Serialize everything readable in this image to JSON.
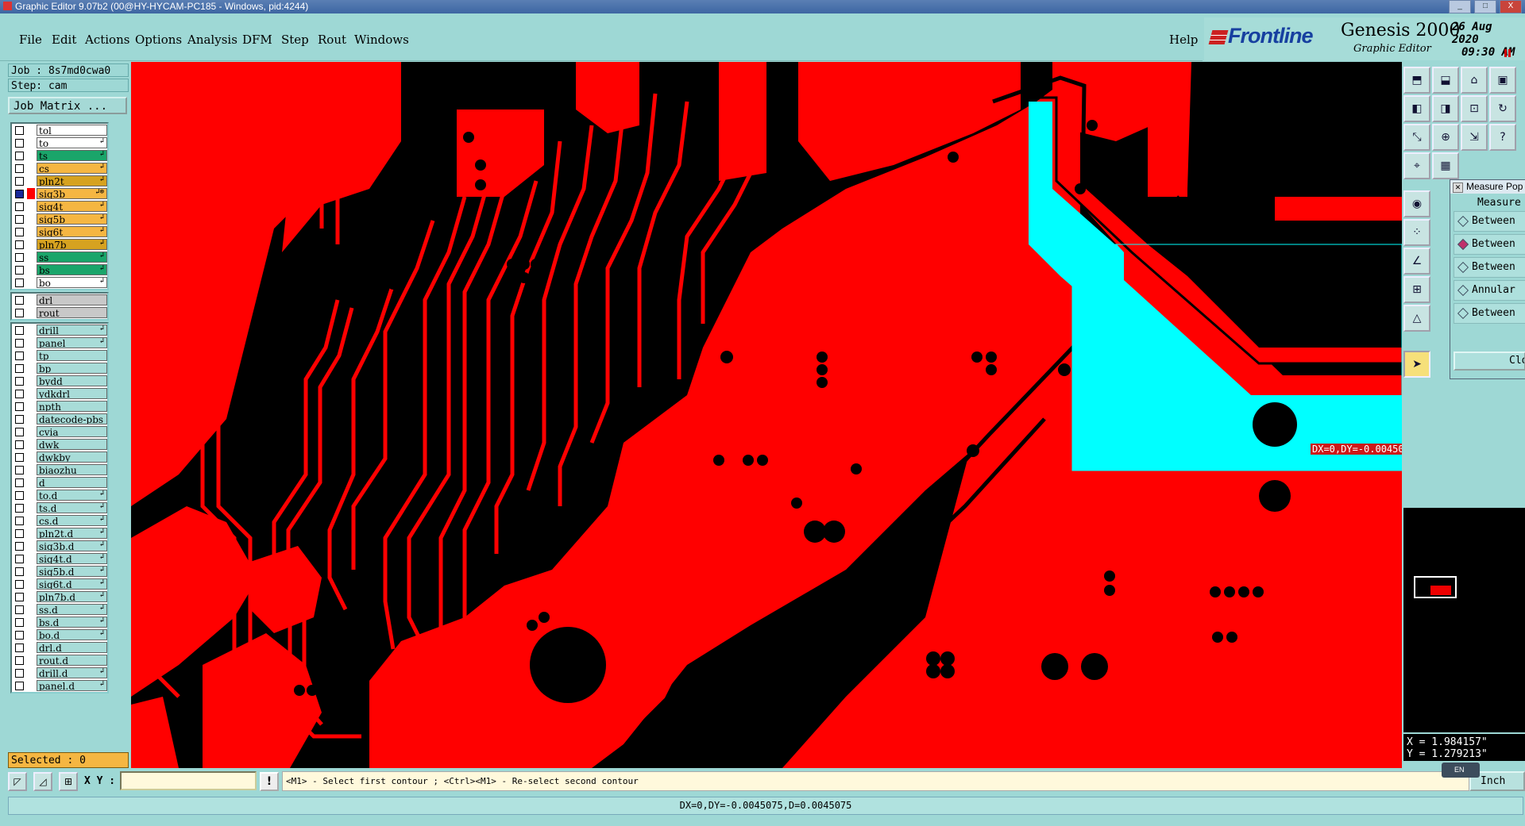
{
  "window": {
    "title": "Graphic Editor 9.07b2 (00@HY-HYCAM-PC185 - Windows, pid:4244)",
    "controls": [
      "_",
      "□",
      "X"
    ]
  },
  "menu": {
    "items": [
      "File",
      "Edit",
      "Actions",
      "Options",
      "Analysis",
      "DFM",
      "Step",
      "Rout",
      "Windows"
    ],
    "help": "Help"
  },
  "brand": {
    "logo": "Frontline",
    "product": "Genesis 2000",
    "subtitle": "Graphic Editor",
    "date": "26 Aug 2020",
    "time": "09:30 AM"
  },
  "job": {
    "job": "Job : 8s7md0cwa0",
    "step": "Step: cam",
    "matrix_button": "Job Matrix ..."
  },
  "layers_board": [
    {
      "name": "tol",
      "color": "#ffffff",
      "arrow": ""
    },
    {
      "name": "to",
      "color": "#ffffff",
      "arrow": "↲"
    },
    {
      "name": "ts",
      "color": "#1aa56a",
      "arrow": "↲"
    },
    {
      "name": "cs",
      "color": "#f5b642",
      "arrow": "↲"
    },
    {
      "name": "pln2t",
      "color": "#d6a220",
      "arrow": "↲"
    },
    {
      "name": "sig3b",
      "color": "#f5b642",
      "arrow": "↲⊗",
      "active": true
    },
    {
      "name": "sig4t",
      "color": "#f5b642",
      "arrow": "↲"
    },
    {
      "name": "sig5b",
      "color": "#f5b642",
      "arrow": "↲"
    },
    {
      "name": "sig6t",
      "color": "#f5b642",
      "arrow": "↲"
    },
    {
      "name": "pln7b",
      "color": "#d6a220",
      "arrow": "↲"
    },
    {
      "name": "ss",
      "color": "#1aa56a",
      "arrow": "↲"
    },
    {
      "name": "bs",
      "color": "#1aa56a",
      "arrow": "↲"
    },
    {
      "name": "bo",
      "color": "#ffffff",
      "arrow": "↲"
    }
  ],
  "layers_drill": [
    {
      "name": "drl",
      "color": "#c8c8c8",
      "arrow": ""
    },
    {
      "name": "rout",
      "color": "#c8c8c8",
      "arrow": ""
    }
  ],
  "layers_misc": [
    {
      "name": "drill",
      "color": "#a8dcd8",
      "arrow": "↲"
    },
    {
      "name": "panel",
      "color": "#a8dcd8",
      "arrow": "↲"
    },
    {
      "name": "tp",
      "color": "#a8dcd8",
      "arrow": ""
    },
    {
      "name": "bp",
      "color": "#a8dcd8",
      "arrow": ""
    },
    {
      "name": "bydd",
      "color": "#a8dcd8",
      "arrow": ""
    },
    {
      "name": "ydkdrl",
      "color": "#a8dcd8",
      "arrow": ""
    },
    {
      "name": "npth",
      "color": "#a8dcd8",
      "arrow": ""
    },
    {
      "name": "datecode-pbs",
      "color": "#a8dcd8",
      "arrow": ""
    },
    {
      "name": "cvia",
      "color": "#a8dcd8",
      "arrow": ""
    },
    {
      "name": "dwk",
      "color": "#a8dcd8",
      "arrow": ""
    },
    {
      "name": "dwkby",
      "color": "#a8dcd8",
      "arrow": ""
    },
    {
      "name": "biaozhu",
      "color": "#a8dcd8",
      "arrow": ""
    },
    {
      "name": "d",
      "color": "#a8dcd8",
      "arrow": ""
    },
    {
      "name": "to.d",
      "color": "#a8dcd8",
      "arrow": "↲"
    },
    {
      "name": "ts.d",
      "color": "#a8dcd8",
      "arrow": "↲"
    },
    {
      "name": "cs.d",
      "color": "#a8dcd8",
      "arrow": "↲"
    },
    {
      "name": "pln2t.d",
      "color": "#a8dcd8",
      "arrow": "↲"
    },
    {
      "name": "sig3b.d",
      "color": "#a8dcd8",
      "arrow": "↲"
    },
    {
      "name": "sig4t.d",
      "color": "#a8dcd8",
      "arrow": "↲"
    },
    {
      "name": "sig5b.d",
      "color": "#a8dcd8",
      "arrow": "↲"
    },
    {
      "name": "sig6t.d",
      "color": "#a8dcd8",
      "arrow": "↲"
    },
    {
      "name": "pln7b.d",
      "color": "#a8dcd8",
      "arrow": "↲"
    },
    {
      "name": "ss.d",
      "color": "#a8dcd8",
      "arrow": "↲"
    },
    {
      "name": "bs.d",
      "color": "#a8dcd8",
      "arrow": "↲"
    },
    {
      "name": "bo.d",
      "color": "#a8dcd8",
      "arrow": "↲"
    },
    {
      "name": "drl.d",
      "color": "#a8dcd8",
      "arrow": ""
    },
    {
      "name": "rout.d",
      "color": "#a8dcd8",
      "arrow": ""
    },
    {
      "name": "drill.d",
      "color": "#a8dcd8",
      "arrow": "↲"
    },
    {
      "name": "panel.d",
      "color": "#a8dcd8",
      "arrow": "↲"
    }
  ],
  "selected": "Selected : 0",
  "measure_label": "DX=0,DY=-0.0045075,D=0.0045075",
  "measure_popup": {
    "title": "Measure Pop",
    "heading": "Measure",
    "options": [
      {
        "label": "Between",
        "selected": false
      },
      {
        "label": "Between",
        "selected": true
      },
      {
        "label": "Between",
        "selected": false
      },
      {
        "label": "Annular",
        "selected": false
      },
      {
        "label": "Between",
        "selected": false
      }
    ],
    "close": "Clo"
  },
  "coords": {
    "x": "X = 1.984157\"",
    "y": "Y = 1.279213\""
  },
  "bottom": {
    "xy_label": "X Y :",
    "xy_value": "",
    "prompt": "<M1> - Select first contour ; <Ctrl><M1> - Re-select second contour",
    "units": "Inch",
    "ime": "EN"
  },
  "status": "DX=0,DY=-0.0045075,D=0.0045075",
  "colors": {
    "copper": "#ff0000",
    "highlight": "#00ffff",
    "background": "#000000",
    "panel": "#9ed8d5"
  }
}
